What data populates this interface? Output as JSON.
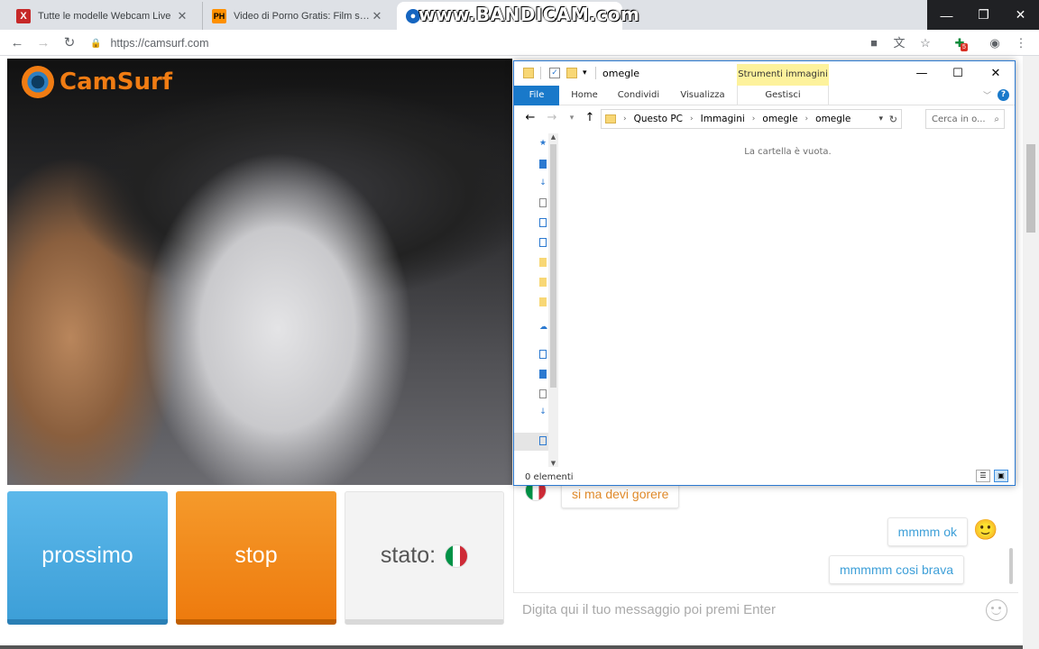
{
  "browser": {
    "tabs": [
      {
        "favicon": "X",
        "title": "Tutte le modelle Webcam Live"
      },
      {
        "favicon": "PH",
        "title": "Video di Porno Gratis: Film sesso"
      },
      {
        "favicon": "",
        "title": ""
      }
    ],
    "watermark": "www.BANDICAM.com",
    "url": "https://camsurf.com",
    "extension_badge": "5"
  },
  "camsurf": {
    "logo_text": "CamSurf",
    "next_label": "prossimo",
    "stop_label": "stop",
    "status_label": "stato:",
    "colors": {
      "next": "#3d9fd8",
      "stop": "#ee7b0e",
      "status_bg": "#f3f3f3"
    }
  },
  "chat": {
    "messages": [
      {
        "from": "stranger",
        "text": "si ma devi gorere"
      },
      {
        "from": "me",
        "text": "mmmm ok"
      },
      {
        "from": "me",
        "text": "mmmmm cosi brava"
      }
    ],
    "input_placeholder": "Digita qui il tuo messaggio poi premi Enter"
  },
  "explorer": {
    "window_title": "omegle",
    "contextual_tab_group": "Strumenti immagini",
    "ribbon_tabs": [
      "File",
      "Home",
      "Condividi",
      "Visualizza",
      "Gestisci"
    ],
    "breadcrumb": [
      "Questo PC",
      "Immagini",
      "omegle",
      "omegle"
    ],
    "search_placeholder": "Cerca in o...",
    "empty_message": "La cartella è vuota.",
    "status": "0 elementi"
  }
}
